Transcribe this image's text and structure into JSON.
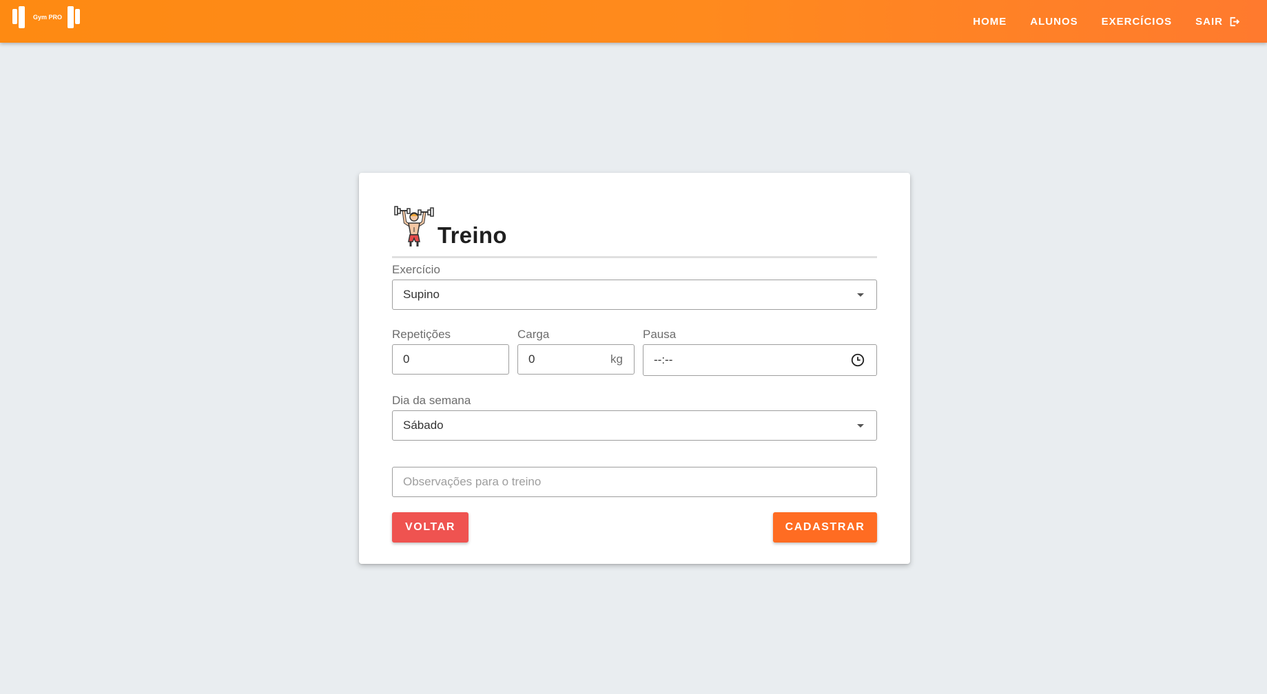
{
  "brand": {
    "name": "Gym PRO"
  },
  "nav": {
    "home": "HOME",
    "alunos": "ALUNOS",
    "exercicios": "EXERCÍCIOS",
    "sair": "SAIR"
  },
  "form": {
    "title": "Treino",
    "exercise": {
      "label": "Exercício",
      "value": "Supino"
    },
    "reps": {
      "label": "Repetições",
      "value": "0"
    },
    "load": {
      "label": "Carga",
      "value": "0",
      "unit": "kg"
    },
    "pause": {
      "label": "Pausa",
      "value": "--:--"
    },
    "weekday": {
      "label": "Dia da semana",
      "value": "Sábado"
    },
    "notes": {
      "placeholder": "Observações para o treino"
    },
    "back_label": "VOLTAR",
    "submit_label": "CADASTRAR"
  },
  "colors": {
    "navbar": "#ff8a1d",
    "back_button": "#ef5350",
    "submit_button": "#ff6c22",
    "background": "#e9edf0"
  },
  "icons": {
    "logo": "barbell-logo-icon",
    "logout": "logout-icon",
    "header": "weightlifter-icon",
    "select": "chevron-down-icon",
    "time": "clock-icon"
  }
}
